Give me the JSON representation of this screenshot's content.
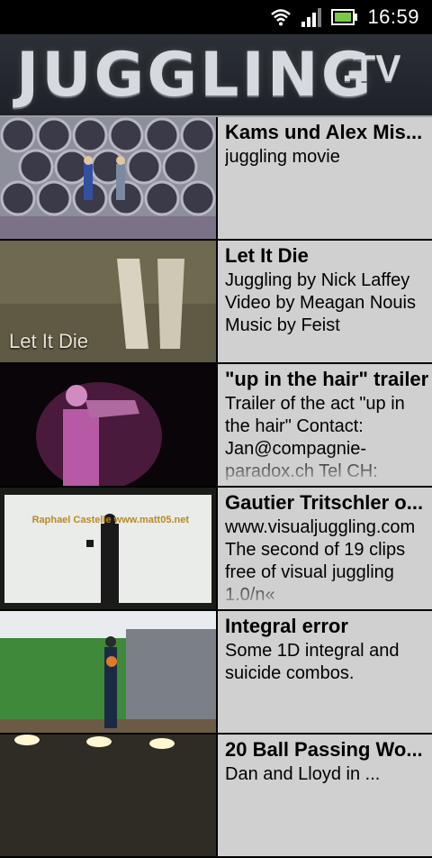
{
  "status": {
    "time": "16:59"
  },
  "header": {
    "logo": "JUGGLING",
    "logo_suffix": ".TV"
  },
  "videos": [
    {
      "title": "Kams und Alex Mis...",
      "description": "juggling movie",
      "thumbnail_overlay": ""
    },
    {
      "title": "Let It Die",
      "description": "Juggling by Nick Laffey Video by Meagan Nouis Music by Feist",
      "thumbnail_overlay": "Let It Die"
    },
    {
      "title": "\"up in the hair\" trailer",
      "description": "Trailer of the act \"up in the hair\" Contact: Jan@compagnie-paradox.ch Tel CH:",
      "thumbnail_overlay": ""
    },
    {
      "title": "Gautier Tritschler o...",
      "description": "www.visualjuggling.com The second of 19 clips free of visual juggling 1.0/n«",
      "thumbnail_overlay": "Raphael Castelle www.matt05.net"
    },
    {
      "title": "Integral error",
      "description": "Some 1D integral and suicide combos.",
      "thumbnail_overlay": ""
    },
    {
      "title": "20 Ball Passing Wo...",
      "description": "Dan and Lloyd in ...",
      "thumbnail_overlay": ""
    }
  ]
}
